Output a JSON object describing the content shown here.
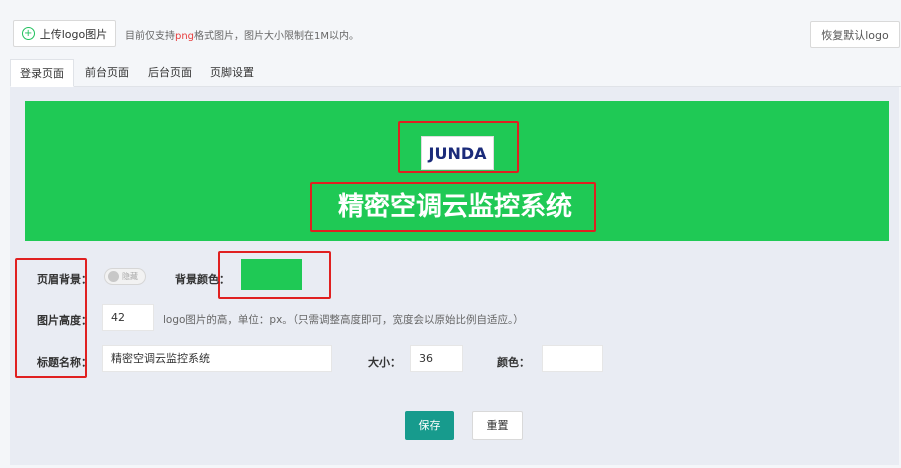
{
  "toolbar": {
    "upload_label": "上传logo图片",
    "hint_prefix": "目前仅支持",
    "hint_format": "png",
    "hint_suffix": "格式图片，图片大小限制在1M以内。",
    "restore_label": "恢复默认logo"
  },
  "tabs": [
    {
      "label": "登录页面",
      "active": true
    },
    {
      "label": "前台页面",
      "active": false
    },
    {
      "label": "后台页面",
      "active": false
    },
    {
      "label": "页脚设置",
      "active": false
    }
  ],
  "preview": {
    "background_color": "#1fc955",
    "logo_text": "JUNDA",
    "title": "精密空调云监控系统"
  },
  "form": {
    "header_bg_label": "页眉背景：",
    "toggle_label": "隐藏",
    "bg_color_label": "背景颜色：",
    "bg_color_value": "#1fc955",
    "image_height_label": "图片高度：",
    "image_height_value": "42",
    "image_height_desc": "logo图片的高，单位：px。（只需调整高度即可，宽度会以原始比例自适应。）",
    "title_name_label": "标题名称：",
    "title_name_value": "精密空调云监控系统",
    "size_label": "大小：",
    "size_value": "36",
    "color_label": "颜色：",
    "color_value": ""
  },
  "actions": {
    "save_label": "保存",
    "reset_label": "重置"
  }
}
